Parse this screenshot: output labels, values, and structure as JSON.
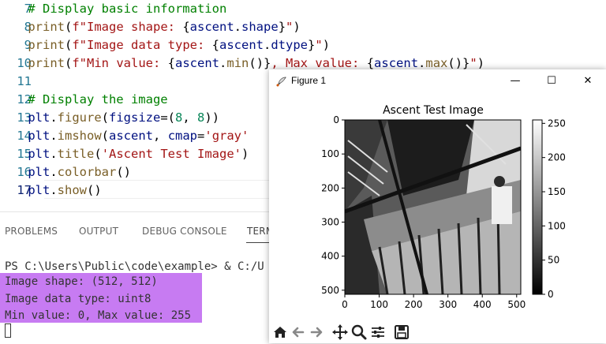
{
  "editor": {
    "lines": [
      {
        "num": "7",
        "tokens": [
          {
            "t": "    ",
            "c": "txt"
          },
          {
            "t": "# Display basic information",
            "c": "com"
          }
        ]
      },
      {
        "num": "8",
        "tokens": [
          {
            "t": "    ",
            "c": "txt"
          },
          {
            "t": "print",
            "c": "fn"
          },
          {
            "t": "(",
            "c": "txt"
          },
          {
            "t": "f\"Image shape: ",
            "c": "str"
          },
          {
            "t": "{",
            "c": "txt"
          },
          {
            "t": "ascent",
            "c": "var"
          },
          {
            "t": ".",
            "c": "txt"
          },
          {
            "t": "shape",
            "c": "var"
          },
          {
            "t": "}",
            "c": "txt"
          },
          {
            "t": "\"",
            "c": "str"
          },
          {
            "t": ")",
            "c": "txt"
          }
        ]
      },
      {
        "num": "9",
        "tokens": [
          {
            "t": "    ",
            "c": "txt"
          },
          {
            "t": "print",
            "c": "fn"
          },
          {
            "t": "(",
            "c": "txt"
          },
          {
            "t": "f\"Image data type: ",
            "c": "str"
          },
          {
            "t": "{",
            "c": "txt"
          },
          {
            "t": "ascent",
            "c": "var"
          },
          {
            "t": ".",
            "c": "txt"
          },
          {
            "t": "dtype",
            "c": "var"
          },
          {
            "t": "}",
            "c": "txt"
          },
          {
            "t": "\"",
            "c": "str"
          },
          {
            "t": ")",
            "c": "txt"
          }
        ]
      },
      {
        "num": "10",
        "tokens": [
          {
            "t": "    ",
            "c": "txt"
          },
          {
            "t": "print",
            "c": "fn"
          },
          {
            "t": "(",
            "c": "txt"
          },
          {
            "t": "f\"Min value: ",
            "c": "str"
          },
          {
            "t": "{",
            "c": "txt"
          },
          {
            "t": "ascent",
            "c": "var"
          },
          {
            "t": ".",
            "c": "txt"
          },
          {
            "t": "min",
            "c": "fn"
          },
          {
            "t": "()}",
            "c": "txt"
          },
          {
            "t": ", Max value: ",
            "c": "str"
          },
          {
            "t": "{",
            "c": "txt"
          },
          {
            "t": "ascent",
            "c": "var"
          },
          {
            "t": ".",
            "c": "txt"
          },
          {
            "t": "max",
            "c": "fn"
          },
          {
            "t": "()}",
            "c": "txt"
          },
          {
            "t": "\"",
            "c": "str"
          },
          {
            "t": ")",
            "c": "txt"
          }
        ]
      },
      {
        "num": "11",
        "tokens": []
      },
      {
        "num": "12",
        "tokens": [
          {
            "t": "    ",
            "c": "txt"
          },
          {
            "t": "# Display the image",
            "c": "com"
          }
        ]
      },
      {
        "num": "13",
        "tokens": [
          {
            "t": "    ",
            "c": "txt"
          },
          {
            "t": "plt",
            "c": "var"
          },
          {
            "t": ".",
            "c": "txt"
          },
          {
            "t": "figure",
            "c": "fn"
          },
          {
            "t": "(",
            "c": "txt"
          },
          {
            "t": "figsize",
            "c": "var"
          },
          {
            "t": "=(",
            "c": "txt"
          },
          {
            "t": "8",
            "c": "num"
          },
          {
            "t": ", ",
            "c": "txt"
          },
          {
            "t": "8",
            "c": "num"
          },
          {
            "t": "))",
            "c": "txt"
          }
        ]
      },
      {
        "num": "14",
        "tokens": [
          {
            "t": "    ",
            "c": "txt"
          },
          {
            "t": "plt",
            "c": "var"
          },
          {
            "t": ".",
            "c": "txt"
          },
          {
            "t": "imshow",
            "c": "fn"
          },
          {
            "t": "(",
            "c": "txt"
          },
          {
            "t": "ascent",
            "c": "var"
          },
          {
            "t": ", ",
            "c": "txt"
          },
          {
            "t": "cmap",
            "c": "var"
          },
          {
            "t": "=",
            "c": "txt"
          },
          {
            "t": "'gray'",
            "c": "str"
          }
        ]
      },
      {
        "num": "15",
        "tokens": [
          {
            "t": "    ",
            "c": "txt"
          },
          {
            "t": "plt",
            "c": "var"
          },
          {
            "t": ".",
            "c": "txt"
          },
          {
            "t": "title",
            "c": "fn"
          },
          {
            "t": "(",
            "c": "txt"
          },
          {
            "t": "'Ascent Test Image'",
            "c": "str"
          },
          {
            "t": ")",
            "c": "txt"
          }
        ]
      },
      {
        "num": "16",
        "tokens": [
          {
            "t": "    ",
            "c": "txt"
          },
          {
            "t": "plt",
            "c": "var"
          },
          {
            "t": ".",
            "c": "txt"
          },
          {
            "t": "colorbar",
            "c": "fn"
          },
          {
            "t": "()",
            "c": "txt"
          }
        ]
      },
      {
        "num": "17",
        "tokens": [
          {
            "t": "    ",
            "c": "txt"
          },
          {
            "t": "plt",
            "c": "var"
          },
          {
            "t": ".",
            "c": "txt"
          },
          {
            "t": "show",
            "c": "fn"
          },
          {
            "t": "()",
            "c": "txt"
          }
        ],
        "active": true
      }
    ]
  },
  "panel": {
    "tabs": [
      "PROBLEMS",
      "OUTPUT",
      "DEBUG CONSOLE",
      "TERM"
    ],
    "active_tab": "TERM",
    "terminal": {
      "prompt": "PS C:\\Users\\Public\\code\\example> & C:/U",
      "output": [
        "Image shape: (512, 512)",
        "Image data type: uint8",
        "Min value: 0, Max value: 255"
      ],
      "highlight_color": "#c77bf2"
    }
  },
  "figure": {
    "window_title": "Figure 1",
    "minimize": "—",
    "maximize": "☐",
    "close": "✕",
    "plot_title": "Ascent Test Image",
    "x_ticks": [
      "0",
      "100",
      "200",
      "300",
      "400",
      "500"
    ],
    "y_ticks": [
      "0",
      "100",
      "200",
      "300",
      "400",
      "500"
    ],
    "colorbar_ticks": [
      "0",
      "50",
      "100",
      "150",
      "200",
      "250"
    ],
    "toolbar_icons": [
      "home-icon",
      "back-icon",
      "forward-icon",
      "pan-icon",
      "zoom-icon",
      "configure-subplots-icon",
      "save-icon"
    ]
  },
  "colors": {
    "comment": "#008000",
    "function": "#795e26",
    "string": "#a31515",
    "variable": "#001080",
    "number": "#098658",
    "line_number": "#237893"
  }
}
